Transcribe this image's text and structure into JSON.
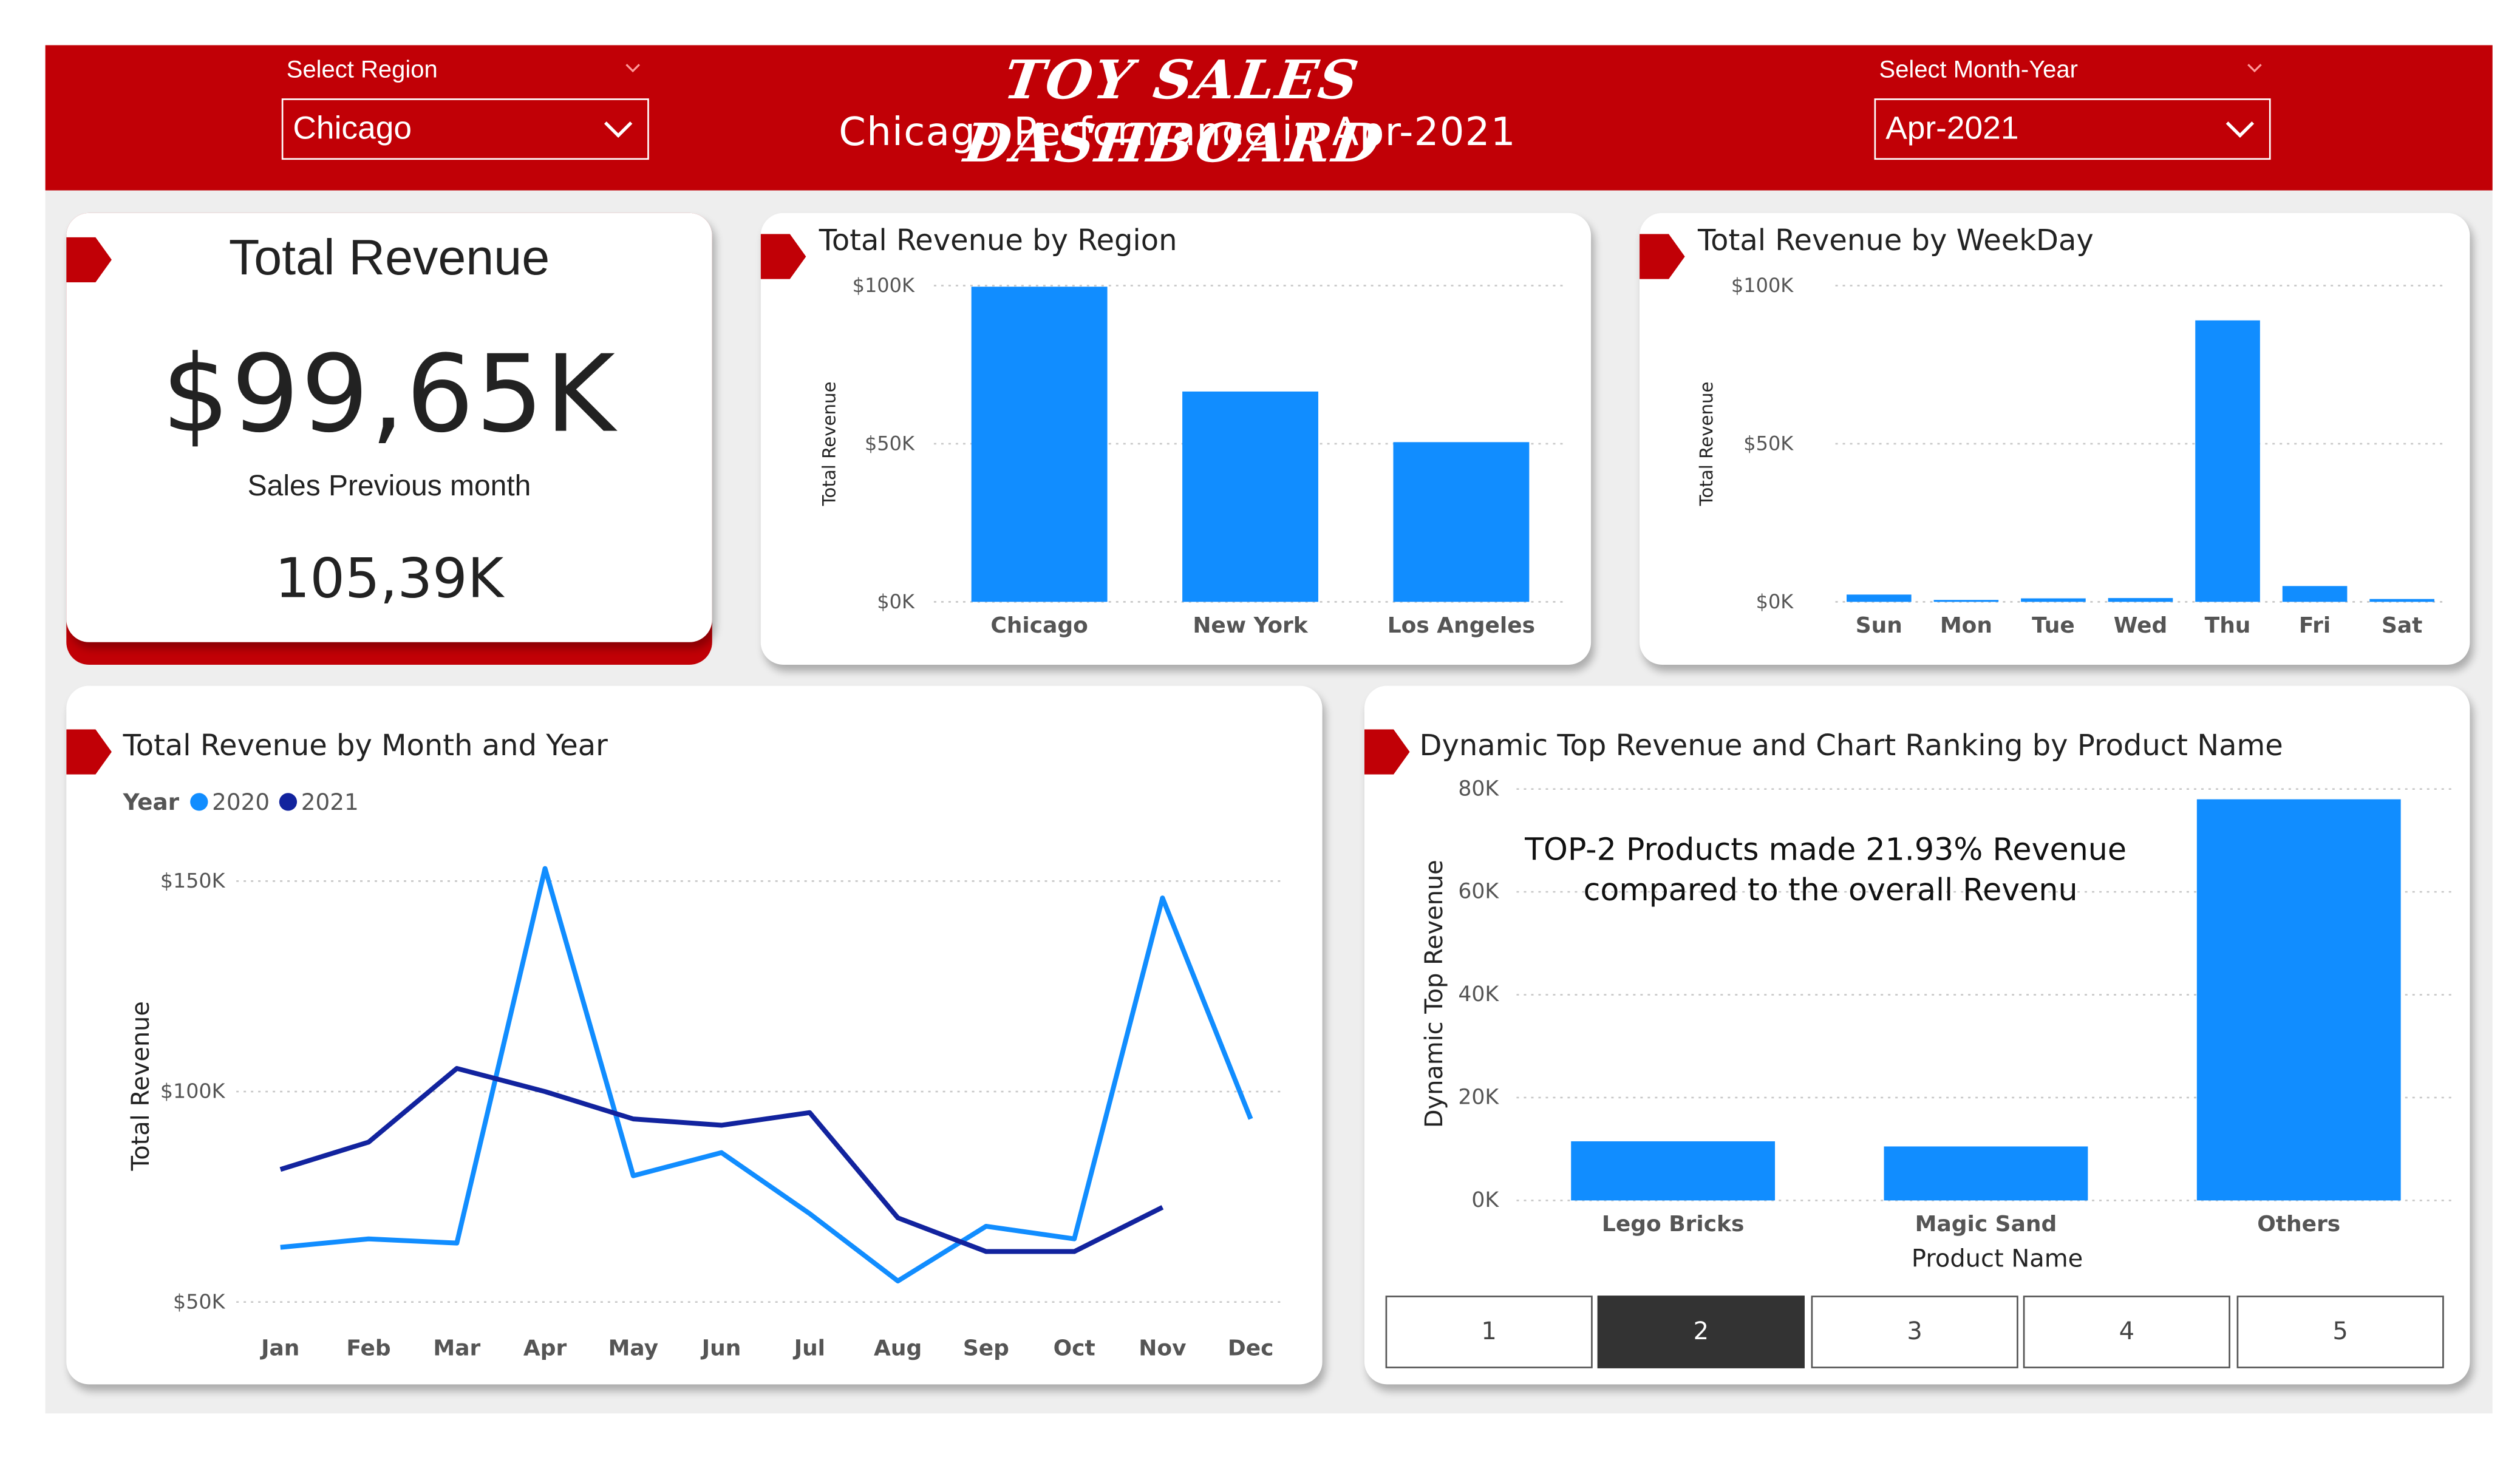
{
  "colors": {
    "brand_red": "#c10006",
    "bar_blue": "#118dff",
    "series_2020": "#118dff",
    "series_2021": "#12239e",
    "card_bg": "#ffffff"
  },
  "header": {
    "title": "TOY SALES DASHBOARD",
    "subtitle": "Chicago Performance in Apr-2021",
    "region_filter": {
      "label": "Select Region",
      "value": "Chicago",
      "icon": "chevron-down-icon"
    },
    "month_filter": {
      "label": "Select Month-Year",
      "value": "Apr-2021",
      "icon": "chevron-down-icon"
    }
  },
  "kpi": {
    "title": "Total Revenue",
    "value": "$99,65K",
    "sub_label": "Sales Previous month",
    "prev_value": "105,39K"
  },
  "chart_data": [
    {
      "type": "bar",
      "title": "Total Revenue by Region",
      "ylabel": "Total Revenue",
      "xlabel": "",
      "ylim": [
        0,
        100000
      ],
      "ytick_labels": [
        "$0K",
        "$50K",
        "$100K"
      ],
      "yticks": [
        0,
        50000,
        100000
      ],
      "categories": [
        "Chicago",
        "New York",
        "Los Angeles"
      ],
      "values": [
        99650,
        66500,
        50500
      ],
      "grid": true
    },
    {
      "type": "bar",
      "title": "Total Revenue by WeekDay",
      "ylabel": "Total Revenue",
      "xlabel": "",
      "ylim": [
        0,
        100000
      ],
      "ytick_labels": [
        "$0K",
        "$50K",
        "$100K"
      ],
      "yticks": [
        0,
        50000,
        100000
      ],
      "categories": [
        "Sun",
        "Mon",
        "Tue",
        "Wed",
        "Thu",
        "Fri",
        "Sat"
      ],
      "values": [
        2300,
        600,
        1100,
        1200,
        89000,
        5000,
        900
      ],
      "grid": true
    },
    {
      "type": "line",
      "title": "Total Revenue by Month and Year",
      "ylabel": "Total Revenue",
      "xlabel": "",
      "legend_title": "Year",
      "legend_position": "top-left",
      "ylim": [
        45000,
        160000
      ],
      "ytick_labels": [
        "$50K",
        "$100K",
        "$150K"
      ],
      "yticks": [
        50000,
        100000,
        150000
      ],
      "categories": [
        "Jan",
        "Feb",
        "Mar",
        "Apr",
        "May",
        "Jun",
        "Jul",
        "Aug",
        "Sep",
        "Oct",
        "Nov",
        "Dec"
      ],
      "series": [
        {
          "name": "2020",
          "values": [
            63000,
            65000,
            64000,
            153000,
            80000,
            85500,
            71000,
            55000,
            68000,
            65000,
            146000,
            93500
          ]
        },
        {
          "name": "2021",
          "values": [
            81500,
            88000,
            105500,
            100000,
            93500,
            92000,
            95000,
            70000,
            62000,
            62000,
            72500,
            null
          ]
        }
      ],
      "grid": true
    },
    {
      "type": "bar",
      "title": "Dynamic Top Revenue and Chart Ranking by Product Name",
      "ylabel": "Dynamic Top Revenue",
      "xlabel": "Product Name",
      "ylim": [
        0,
        80000
      ],
      "ytick_labels": [
        "0K",
        "20K",
        "40K",
        "60K",
        "80K"
      ],
      "yticks": [
        0,
        20000,
        40000,
        60000,
        80000
      ],
      "categories": [
        "Lego Bricks",
        "Magic Sand",
        "Others"
      ],
      "values": [
        11500,
        10500,
        78000
      ],
      "grid": true,
      "annotation": "TOP-2 Products made 21.93% Revenue compared to the overall Revenu"
    }
  ],
  "pager": {
    "buttons": [
      "1",
      "2",
      "3",
      "4",
      "5"
    ],
    "active": "2"
  }
}
